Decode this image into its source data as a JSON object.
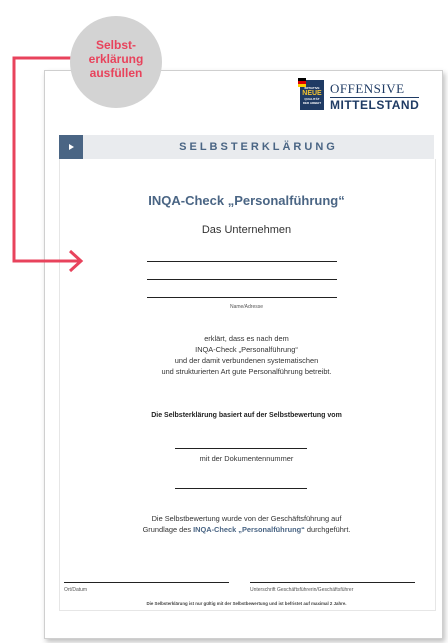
{
  "badge": {
    "line1": "Selbst-",
    "line2": "erklärung",
    "line3": "ausfüllen"
  },
  "logo": {
    "box_small_1": "INITIATIVE",
    "box_neue": "NEUE",
    "box_small_2": "QUALITÄT",
    "box_small_3": "DER ARBEIT",
    "text_top": "OFFENSIVE",
    "text_bottom": "MITTELSTAND"
  },
  "header": {
    "title": "SELBSTERKLÄRUNG"
  },
  "doc": {
    "heading": "INQA-Check „Personalführung“",
    "subheading": "Das Unternehmen",
    "name_label": "Name/Adresse",
    "body": [
      "erklärt, dass es nach dem",
      "INQA-Check „Personalführung“",
      "und der damit verbundenen systematischen",
      "und strukturierten Art gute Personalführung betreibt."
    ],
    "basis": "Die Selbsterklärung basiert auf der Selbstbewertung vom",
    "doc_number": "mit der Dokumentennummer",
    "performed_1": "Die Selbstbewertung wurde von der Geschäftsführung auf",
    "performed_2_pre": "Grundlage des",
    "performed_2_hl": "INQA-Check „Personalführung“",
    "performed_2_post": "durchgeführt.",
    "place_date_label": "Ort/Datum",
    "signature_label": "Unterschrift Geschäftsführerin/Geschäftsführer",
    "footer": "Die Selbsterklärung ist nur gültig mit der Selbstbewertung und ist befristet auf maximal 2 Jahre."
  },
  "colors": {
    "accent": "#4a6584",
    "arrow": "#e8435c",
    "badge_bg": "#d3d3d3"
  }
}
